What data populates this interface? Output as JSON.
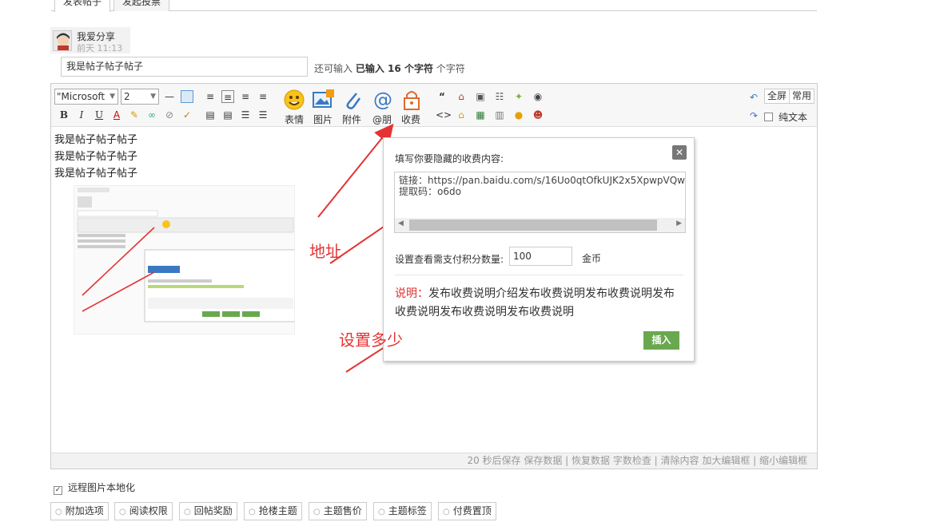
{
  "tabs": [
    "发表帖子",
    "发起投票"
  ],
  "user": {
    "name": "我爱分享",
    "time": "前天 11:13"
  },
  "title": {
    "value": "我是帖子帖子帖子"
  },
  "char_count": {
    "prefix": "还可输入",
    "entered_label": "已输入",
    "count": "16",
    "unit": "个字符",
    "suffix": "个字符"
  },
  "toolbar": {
    "font": "\"Microsoft",
    "size": "2",
    "big_buttons": [
      "表情",
      "图片",
      "附件",
      "@朋",
      "收费"
    ],
    "right_buttons": {
      "fullscreen": "全屏",
      "common": "常用",
      "plain_text": "纯文本"
    }
  },
  "content": {
    "lines": [
      "我是帖子帖子帖子",
      "我是帖子帖子帖子",
      "我是帖子帖子帖子"
    ]
  },
  "statusbar": "20 秒后保存 保存数据 | 恢复数据   字数检查 | 清除内容   加大编辑框 | 缩小编辑框",
  "popup": {
    "heading": "填写你要隐藏的收费内容:",
    "content_line1": "链接：https://pan.baidu.com/s/16Uo0qtOfkUJK2x5XpwpVQw",
    "content_line2": "提取码：o6do",
    "points_label": "设置查看需支付积分数量:",
    "points_value": "100",
    "points_unit": "金币",
    "desc_label": "说明：",
    "desc_text": "发布收费说明介绍发布收费说明发布收费说明发布收费说明发布收费说明发布收费说明",
    "insert": "插入"
  },
  "annotations": {
    "address": "地址",
    "set_amount": "设置多少"
  },
  "remote_local": "远程图片本地化",
  "options": [
    "附加选项",
    "阅读权限",
    "回帖奖励",
    "抢楼主题",
    "主题售价",
    "主题标签",
    "付费置顶"
  ],
  "colors": {
    "accent_red": "#e53333",
    "insert_green": "#6aa84f"
  }
}
